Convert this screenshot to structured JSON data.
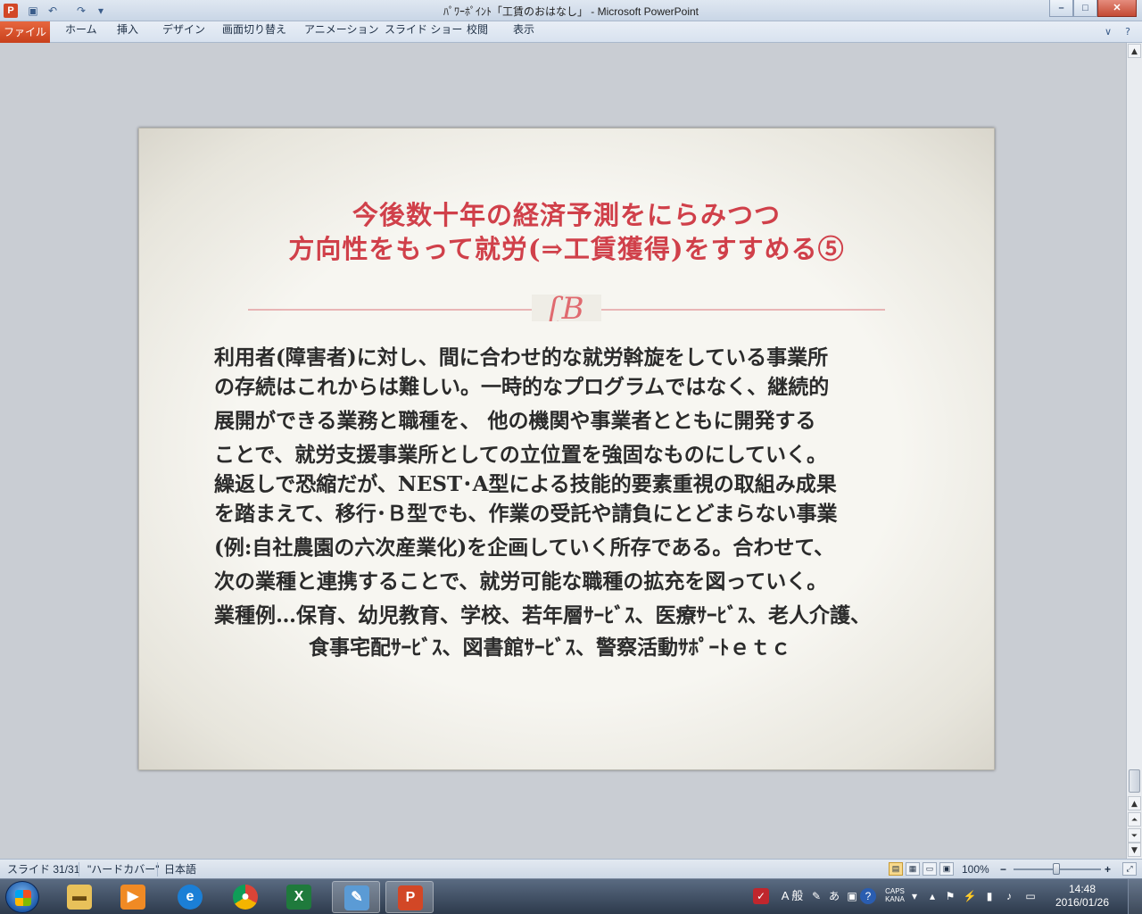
{
  "window": {
    "title": "ﾊﾟﾜｰﾎﾟｲﾝﾄ「工賃のおはなし」 - Microsoft PowerPoint",
    "app_icon": "P",
    "buttons": {
      "minimize": "–",
      "maximize": "□",
      "close": "✕"
    }
  },
  "ribbon": {
    "file_tab": "ファイル",
    "tabs": [
      "ホーム",
      "挿入",
      "デザイン",
      "画面切り替え",
      "アニメーション",
      "スライド ショー",
      "校閲",
      "表示"
    ]
  },
  "slide": {
    "title_lines": [
      "今後数十年の経済予測をにらみつつ",
      "方向性をもって就労(⇒工賃獲得)をすすめる⑤"
    ],
    "ornament": "ʗB",
    "body_lines": [
      "利用者(障害者)に対し、間に合わせ的な就労斡旋をしている事業所",
      "の存続はこれからは難しい。一時的なプログラムではなく、継続的",
      "展開ができる業務と職種を、 他の機関や事業者とともに開発する",
      "ことで、就労支援事業所としての立位置を強固なものにしていく。",
      "繰返しで恐縮だが、NEST･A型による技能的要素重視の取組み成果",
      "を踏まえて、移行･Ｂ型でも、作業の受託や請負にとどまらない事業",
      "(例:自社農園の六次産業化)を企画していく所存である。合わせて、",
      "次の業種と連携することで、就労可能な職種の拡充を図っていく。",
      "業種例…保育、幼児教育、学校、若年層ｻｰﾋﾞｽ、医療ｻｰﾋﾞｽ、老人介護、",
      "食事宅配ｻｰﾋﾞｽ、図書館ｻｰﾋﾞｽ、警察活動ｻﾎﾟｰﾄｅｔｃ"
    ]
  },
  "statusbar": {
    "slide_info": "スライド 31/31",
    "theme": "\"ハードカバー\"",
    "language": "日本語",
    "zoom": "100%",
    "zoom_minus": "−",
    "zoom_plus": "+"
  },
  "taskbar": {
    "tray_ime": "A 般",
    "tray_caps": "CAPS",
    "tray_kana": "KANA",
    "time": "14:48",
    "date": "2016/01/26"
  },
  "colors": {
    "title_red": "#d0404a",
    "file_tab": "#d24726",
    "body_text": "#2b2b2b"
  }
}
